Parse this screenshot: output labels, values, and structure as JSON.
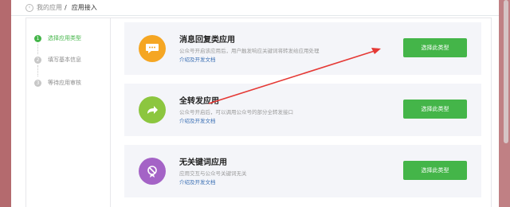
{
  "breadcrumb": {
    "parent": "我的应用",
    "separator": "/",
    "current": "应用接入"
  },
  "steps": [
    {
      "number": "1",
      "label": "选择应用类型"
    },
    {
      "number": "2",
      "label": "填写基本信息"
    },
    {
      "number": "3",
      "label": "等待应用审核"
    }
  ],
  "cards": [
    {
      "title": "消息回复类应用",
      "description": "公众号开启该应用后，用户触发响应关键词将转发给应用处理",
      "link": "介绍及开发文档",
      "button": "选择此类型",
      "icon": "chat-bubble-icon",
      "icon_color": "#f5a623"
    },
    {
      "title": "全转发应用",
      "description": "公众号开启后，可以调用公众号的部分全转发接口",
      "link": "介绍及开发文档",
      "button": "选择此类型",
      "icon": "forward-arrow-icon",
      "icon_color": "#8cc63f"
    },
    {
      "title": "无关键词应用",
      "description": "应用交互与公众号关键词无关",
      "link": "介绍及开发文档",
      "button": "选择此类型",
      "icon": "no-keyword-icon",
      "icon_color": "#a463c6"
    }
  ],
  "colors": {
    "accent_green": "#44b549",
    "annotation_arrow": "#e53935"
  }
}
